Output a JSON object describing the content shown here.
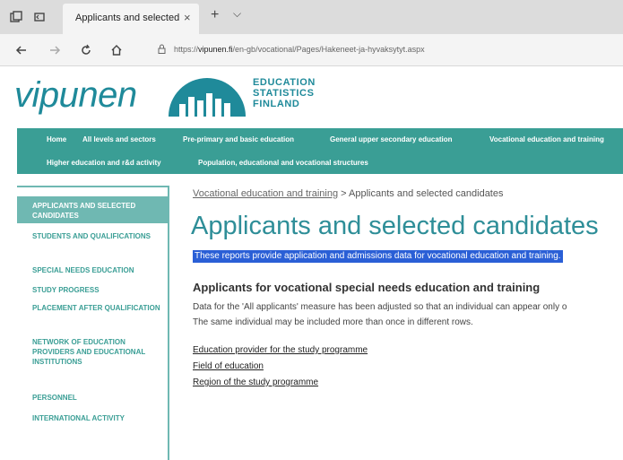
{
  "browser": {
    "tab_title": "Applicants and selected",
    "tab_close_glyph": "×",
    "new_tab_glyph": "+",
    "tab_menu_glyph": "⌵",
    "url_prefix": "https://",
    "url_host": "vipunen.fi",
    "url_path": "/en-gb/vocational/Pages/Hakeneet-ja-hyvaksytyt.aspx"
  },
  "logo": {
    "wordmark": "vipunen",
    "subtitle_lines": [
      "EDUCATION",
      "STATISTICS",
      "FINLAND"
    ],
    "color": "#1f8a9a"
  },
  "main_nav": {
    "row1": [
      "Home",
      "All levels and sectors",
      "Pre-primary and basic education",
      "General upper secondary education",
      "Vocational education and training"
    ],
    "row2": [
      "Higher education and r&d activity",
      "Population, educational and vocational structures"
    ],
    "background": "#3a9e95"
  },
  "sidebar": {
    "items": [
      {
        "label": "APPLICANTS AND SELECTED CANDIDATES",
        "active": true
      },
      {
        "label": "STUDENTS AND QUALIFICATIONS",
        "active": false
      },
      {
        "label": "SPECIAL NEEDS EDUCATION",
        "active": false
      },
      {
        "label": "STUDY PROGRESS",
        "active": false
      },
      {
        "label": "PLACEMENT AFTER QUALIFICATION",
        "active": false
      },
      {
        "label": "NETWORK OF EDUCATION PROVIDERS AND EDUCATIONAL INSTITUTIONS",
        "active": false
      },
      {
        "label": "PERSONNEL",
        "active": false
      },
      {
        "label": "INTERNATIONAL ACTIVITY",
        "active": false
      }
    ]
  },
  "breadcrumb": {
    "parent": "Vocational education and training",
    "separator": ">",
    "current": "Applicants and selected candidates"
  },
  "page": {
    "title": "Applicants and selected candidates",
    "intro": "These reports provide application and admissions data for vocational education and training.",
    "section_heading": "Applicants for vocational special needs education and training",
    "paragraph_line1": "Data for the 'All applicants' measure has been adjusted so that an individual can appear only o",
    "paragraph_line2": "The same individual may be included more than once in different rows.",
    "report_links": [
      "Education provider for the study programme",
      "Field of education",
      "Region of the study programme"
    ]
  }
}
